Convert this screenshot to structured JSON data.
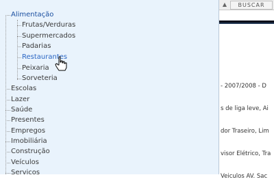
{
  "search": {
    "button_label": "BUSCAR",
    "scroll_up_glyph": "▲"
  },
  "tree": {
    "open_category": {
      "label": "Alimentação",
      "children": [
        "Frutas/Verduras",
        "Supermercados",
        "Padarias",
        "Restaurantes",
        "Peixaria",
        "Sorveteria"
      ],
      "hovered_child": "Restaurantes"
    },
    "categories": [
      "Escolas",
      "Lazer",
      "Saúde",
      "Presentes",
      "Empregos",
      "Imobiliária",
      "Construção",
      "Veículos",
      "Serviços"
    ]
  },
  "content": {
    "lines": [
      "- 2007/2008 - D",
      "s de liga leve, Ai",
      "dor Traseiro, Lim",
      "visor Elétrico, Tra",
      "Veiculos AV. Sac"
    ]
  },
  "colors": {
    "panel_bg": "#e9f3fc",
    "link_blue": "#1a4fa0",
    "hover_blue": "#2a66c4",
    "divider_dark": "#0a0f1a"
  },
  "icons": {
    "cursor": "hand-pointer-icon"
  }
}
